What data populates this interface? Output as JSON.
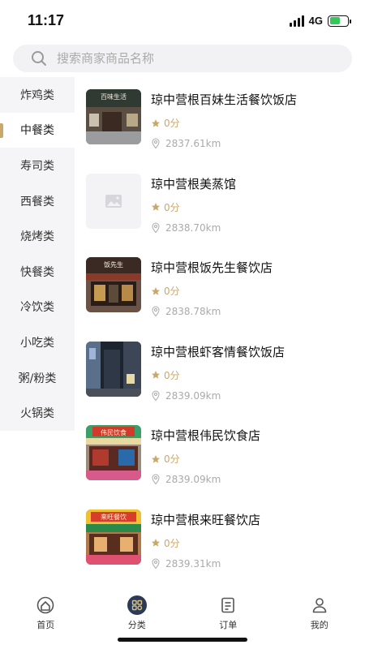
{
  "status": {
    "time": "11:17",
    "network": "4G",
    "battery_level": 0.6
  },
  "search": {
    "placeholder": "搜索商家商品名称"
  },
  "sidebar": {
    "items": [
      {
        "label": "炸鸡类"
      },
      {
        "label": "中餐类"
      },
      {
        "label": "寿司类"
      },
      {
        "label": "西餐类"
      },
      {
        "label": "烧烤类"
      },
      {
        "label": "快餐类"
      },
      {
        "label": "冷饮类"
      },
      {
        "label": "小吃类"
      },
      {
        "label": "粥/粉类"
      },
      {
        "label": "火锅类"
      }
    ],
    "active_index": 1
  },
  "shops": [
    {
      "name": "琼中营根百妹生活餐饮饭店",
      "rating": "0分",
      "distance": "2837.61km"
    },
    {
      "name": "琼中营根美蒸馆",
      "rating": "0分",
      "distance": "2838.70km"
    },
    {
      "name": "琼中营根饭先生餐饮店",
      "rating": "0分",
      "distance": "2838.78km"
    },
    {
      "name": "琼中营根虾客情餐饮饭店",
      "rating": "0分",
      "distance": "2839.09km"
    },
    {
      "name": "琼中营根伟民饮食店",
      "rating": "0分",
      "distance": "2839.09km"
    },
    {
      "name": "琼中营根来旺餐饮店",
      "rating": "0分",
      "distance": "2839.31km"
    }
  ],
  "shop_thumbs": [
    {
      "sign": "百味生活",
      "sign_color": "#2f3a33"
    },
    {
      "sign": "",
      "sign_color": ""
    },
    {
      "sign": "饭先生",
      "sign_color": "#3b2a24"
    },
    {
      "sign": "",
      "sign_color": "#1c2430"
    },
    {
      "sign": "伟民饮食",
      "sign_color": "#cf3a2a"
    },
    {
      "sign": "来旺餐饮",
      "sign_color": "#d83c2a"
    }
  ],
  "tabs": [
    {
      "label": "首页",
      "icon": "home-icon"
    },
    {
      "label": "分类",
      "icon": "category-icon"
    },
    {
      "label": "订单",
      "icon": "order-icon"
    },
    {
      "label": "我的",
      "icon": "profile-icon"
    }
  ],
  "colors": {
    "accent_gold": "#c9a86a",
    "active_tab_bg": "#2b3a55"
  }
}
